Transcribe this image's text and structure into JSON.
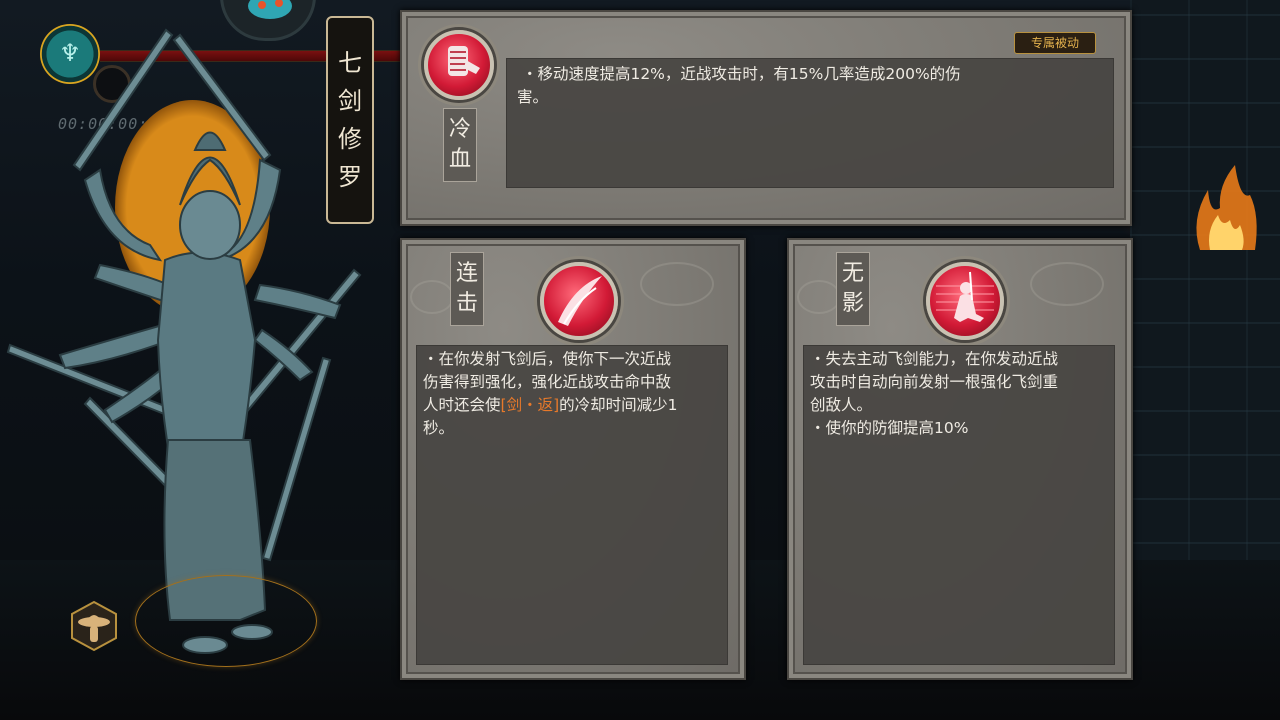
{
  "hud": {
    "emblem_icon": "trident-crest-icon",
    "timer": "00:00:00:00",
    "hp_color": "#7a1010"
  },
  "character": {
    "name_chars": [
      "七",
      "剑",
      "修",
      "罗"
    ]
  },
  "passive": {
    "badge": "专属被动",
    "name_chars": [
      "冷",
      "血"
    ],
    "icon": "bandaged-fist-icon",
    "description_prefix": "・",
    "description_lines": [
      "移动速度提高12%，近战攻击时，有15%几率造成200%的伤",
      "害。"
    ]
  },
  "skill_left": {
    "name_chars": [
      "连",
      "击"
    ],
    "icon": "sword-slash-icon",
    "lines": [
      "・在你发射飞剑后，使你下一次近战",
      "伤害得到强化，强化近战攻击命中敌",
      "人时还会使",
      "的冷却时间减少1",
      "秒。"
    ],
    "highlight": "[剑・返]"
  },
  "skill_right": {
    "name_chars": [
      "无",
      "影"
    ],
    "icon": "kneeling-swordsman-icon",
    "lines": [
      "・失去主动飞剑能力，在你发动近战",
      "攻击时自动向前发射一根强化飞剑重",
      "创敌人。",
      "・使你的防御提高10%"
    ]
  },
  "colors": {
    "accent_red": "#d21a36",
    "highlight_orange": "#e8792a",
    "badge_gold": "#e2b04d"
  }
}
